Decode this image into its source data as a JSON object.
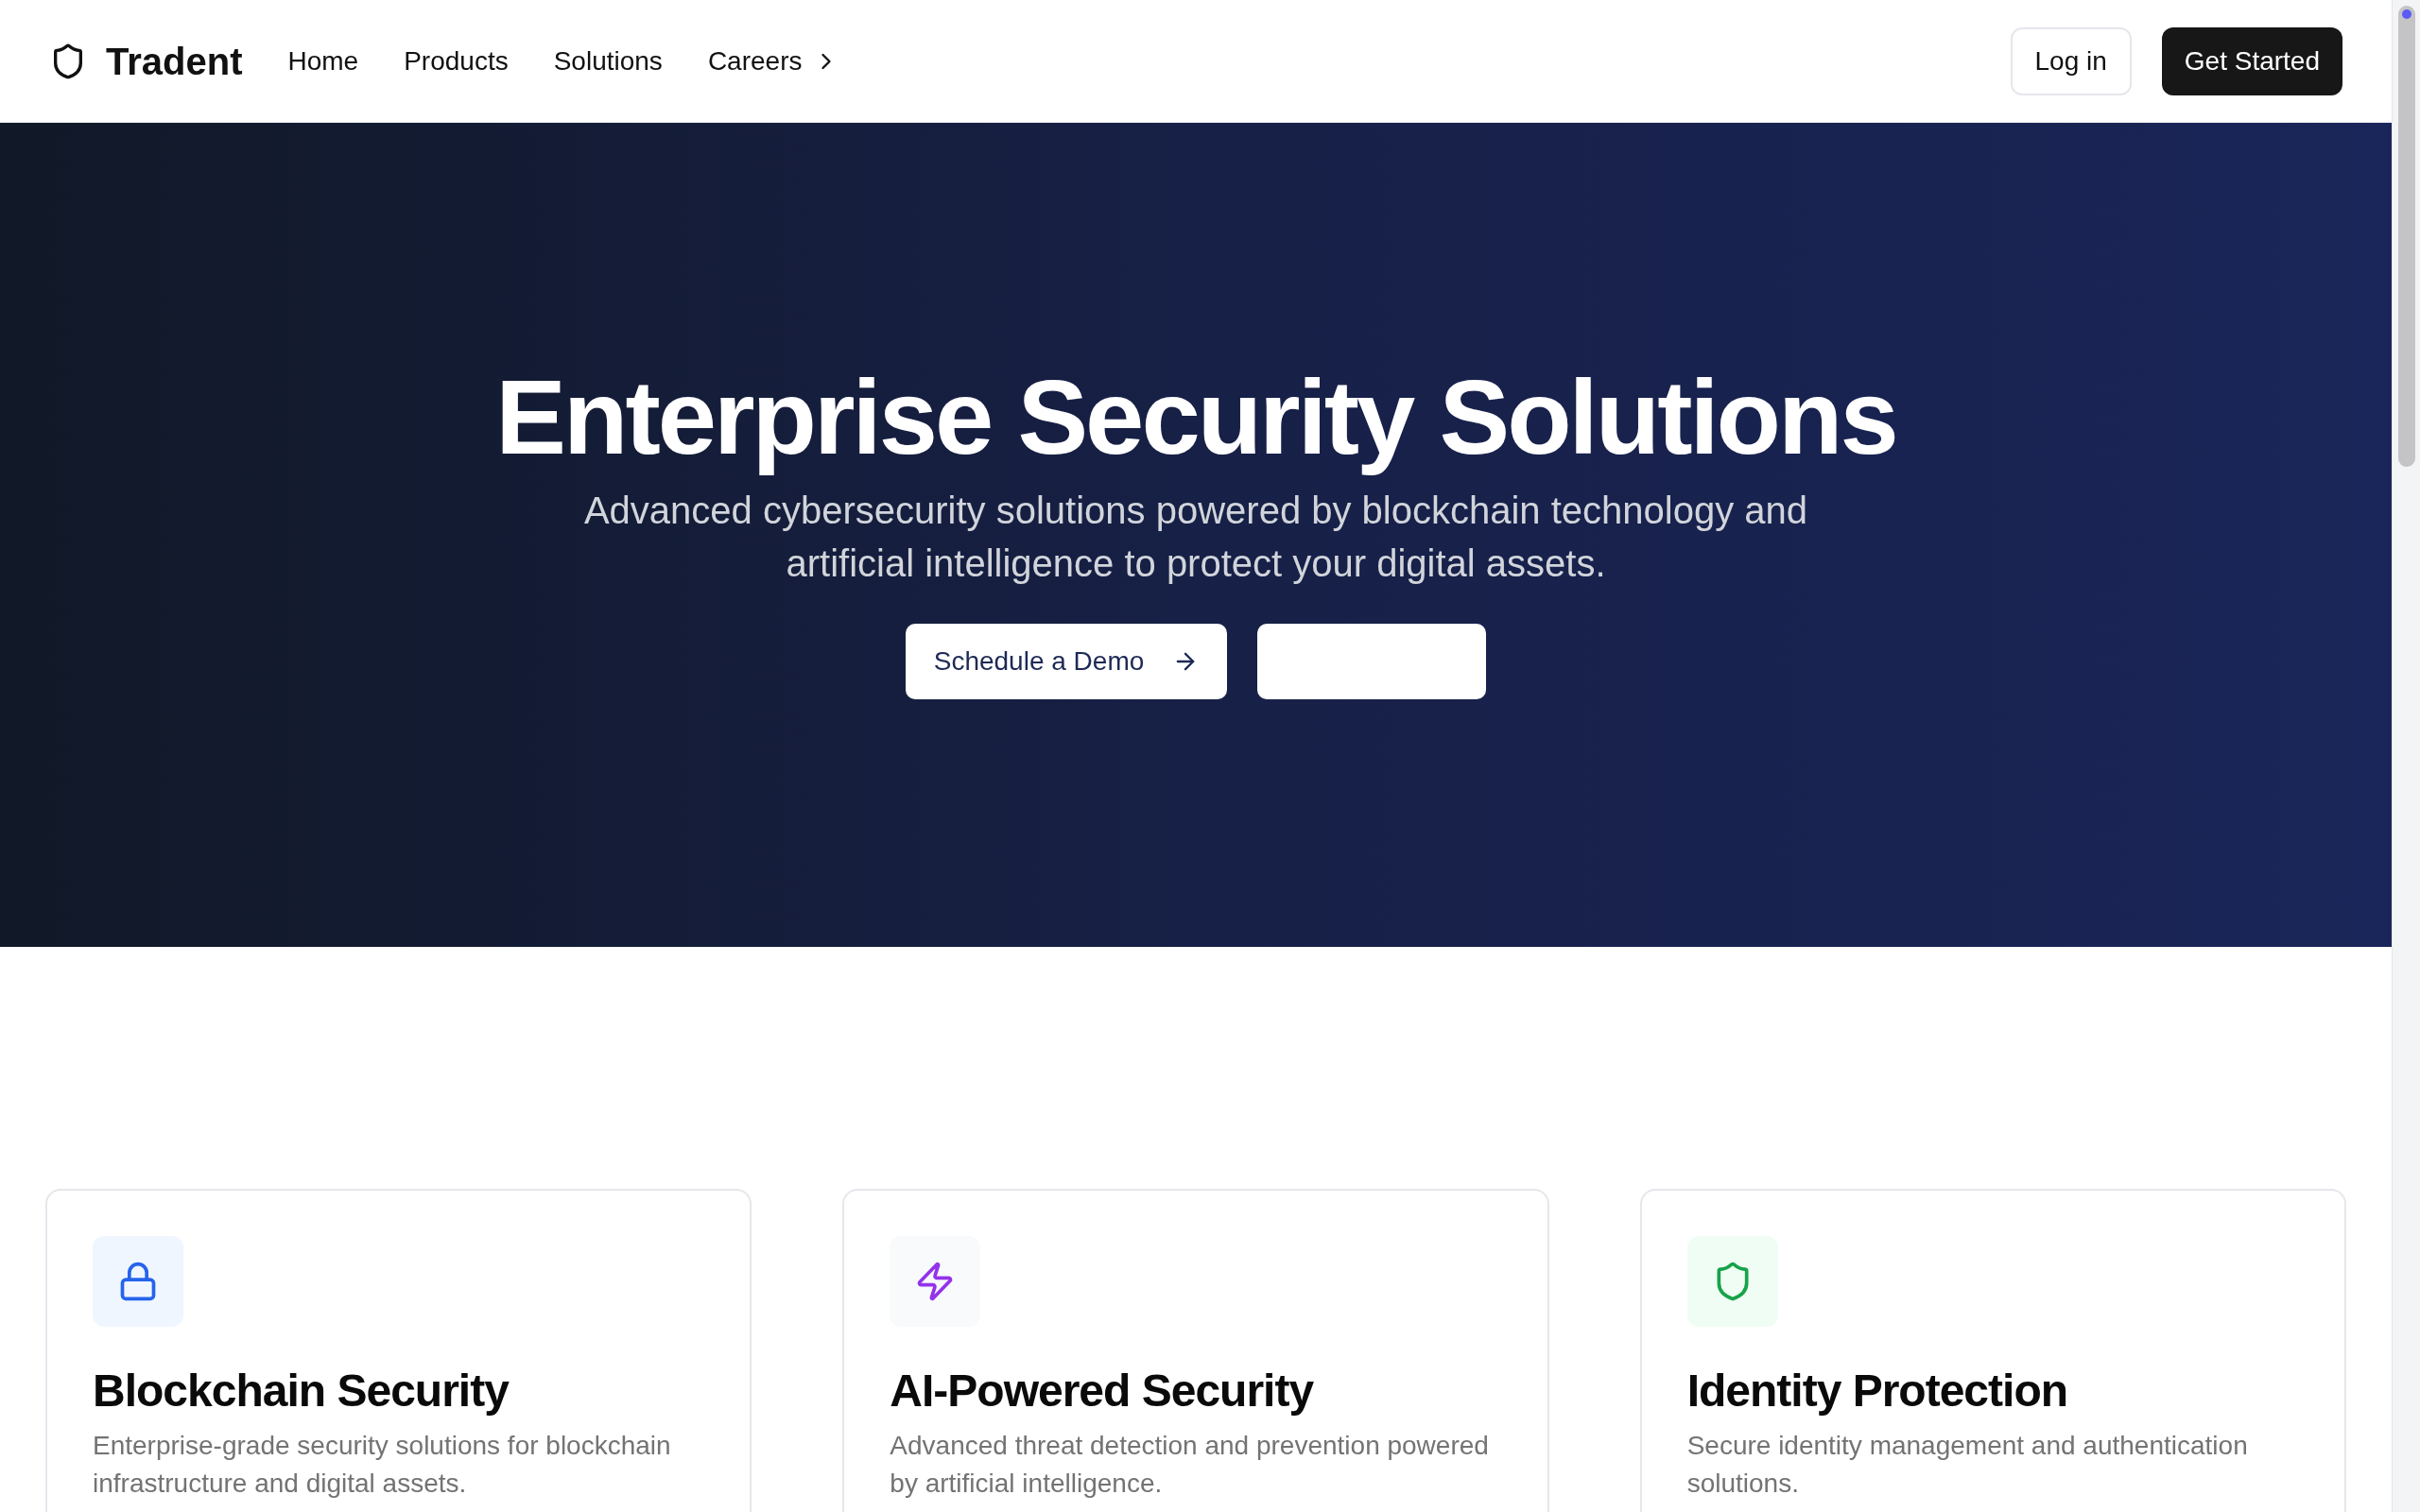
{
  "nav": {
    "brand": "Tradent",
    "links": [
      {
        "label": "Home",
        "kind": "plain"
      },
      {
        "label": "Products",
        "kind": "plain"
      },
      {
        "label": "Solutions",
        "kind": "plain"
      },
      {
        "label": "Careers",
        "kind": "chevron"
      }
    ],
    "login": "Log in",
    "cta": "Get Started"
  },
  "hero": {
    "title": "Enterprise Security Solutions",
    "subtitle": "Advanced cybersecurity solutions powered by blockchain technology and artificial intelligence to protect your digital assets.",
    "primary_button": "Schedule a Demo"
  },
  "features": [
    {
      "kind": "lock",
      "color": "#2563eb",
      "title": "Blockchain Security",
      "description": "Enterprise-grade security solutions for blockchain infrastructure and digital assets."
    },
    {
      "kind": "bolt",
      "color": "#9333ea",
      "title": "AI-Powered Security",
      "description": "Advanced threat detection and prevention powered by artificial intelligence."
    },
    {
      "kind": "shield",
      "color": "#16a34a",
      "title": "Identity Protection",
      "description": "Secure identity management and authentication solutions."
    }
  ]
}
